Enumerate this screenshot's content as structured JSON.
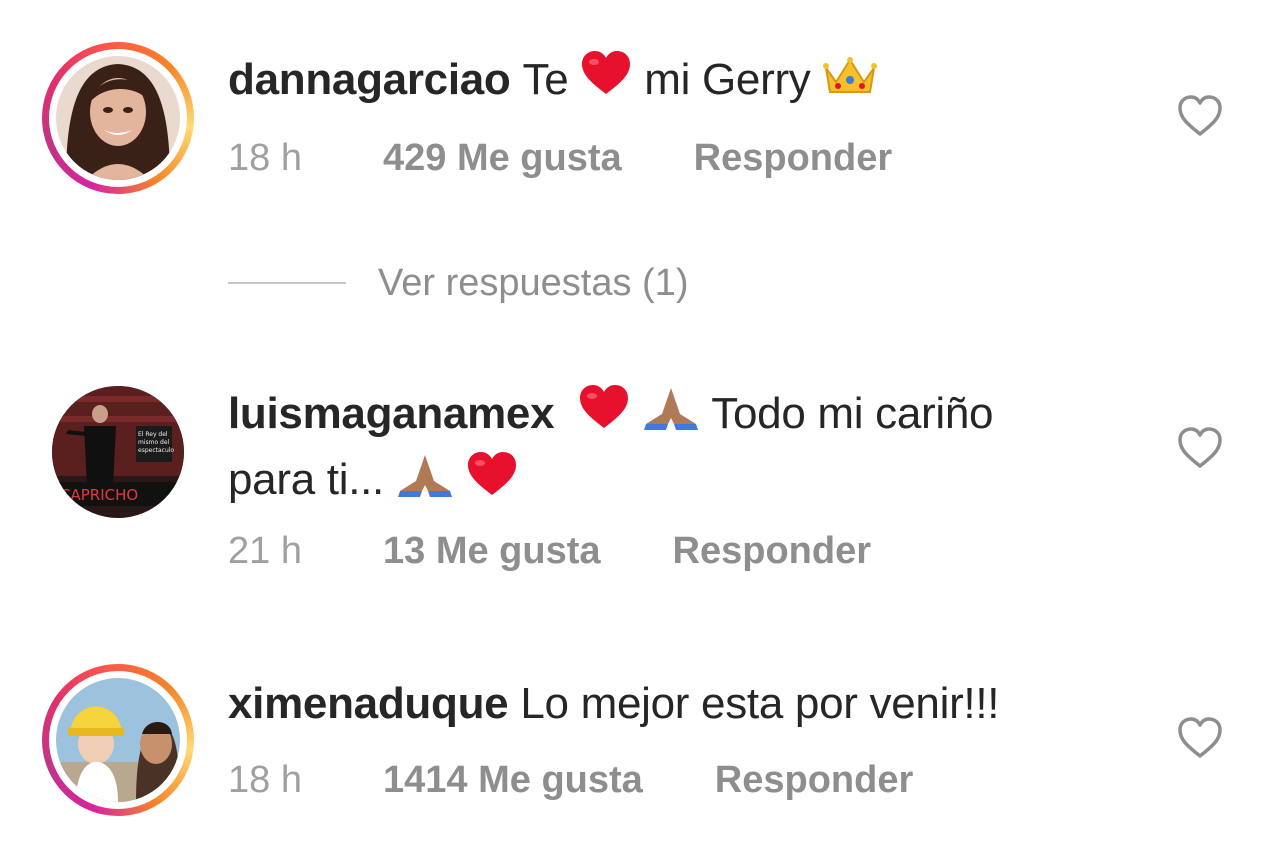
{
  "comments": [
    {
      "username": "dannagarciao",
      "text_before": "Te",
      "text_after": "mi Gerry",
      "time": "18 h",
      "likes": "429 Me gusta",
      "reply": "Responder"
    },
    {
      "username": "luismaganamex",
      "text_line1": "Todo mi cariño",
      "text_line2": "para ti...",
      "time": "21 h",
      "likes": "13 Me gusta",
      "reply": "Responder",
      "avatar_caption": "CAPRICHO"
    },
    {
      "username": "ximenaduque",
      "text": "Lo mejor esta por venir!!!",
      "time": "18 h",
      "likes": "1414 Me gusta",
      "reply": "Responder"
    }
  ],
  "view_replies": "Ver respuestas (1)",
  "icons": {
    "like": "heart-outline-icon",
    "red_heart": "red-heart-emoji",
    "crown": "crown-emoji",
    "praying_hands": "folded-hands-emoji"
  },
  "colors": {
    "text": "#262626",
    "muted": "#8e8e8e",
    "red_heart": "#e8112d"
  }
}
